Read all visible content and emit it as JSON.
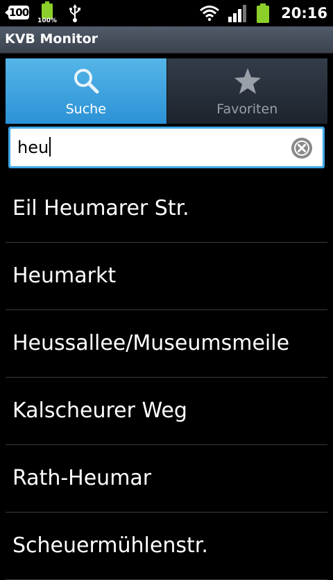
{
  "status_bar": {
    "notification_count": "100",
    "battery_small_percent": "100%",
    "icons": [
      "notification-badge",
      "battery-icon",
      "usb-icon",
      "wifi-icon",
      "signal-icon",
      "battery-icon"
    ],
    "time": "20:16"
  },
  "app": {
    "title": "KVB Monitor"
  },
  "tabs": [
    {
      "label": "Suche",
      "icon": "search-icon",
      "active": true
    },
    {
      "label": "Favoriten",
      "icon": "star-icon",
      "active": false
    }
  ],
  "search": {
    "value": "heu",
    "clear_icon": "clear-icon"
  },
  "results": [
    {
      "label": "Eil Heumarer Str."
    },
    {
      "label": "Heumarkt"
    },
    {
      "label": "Heussallee/Museumsmeile"
    },
    {
      "label": "Kalscheurer Weg"
    },
    {
      "label": "Rath-Heumar"
    },
    {
      "label": "Scheuermühlenstr."
    }
  ],
  "colors": {
    "accent": "#2c92d6",
    "battery_green": "#8ccf2a",
    "title_bar": "#46505c"
  }
}
